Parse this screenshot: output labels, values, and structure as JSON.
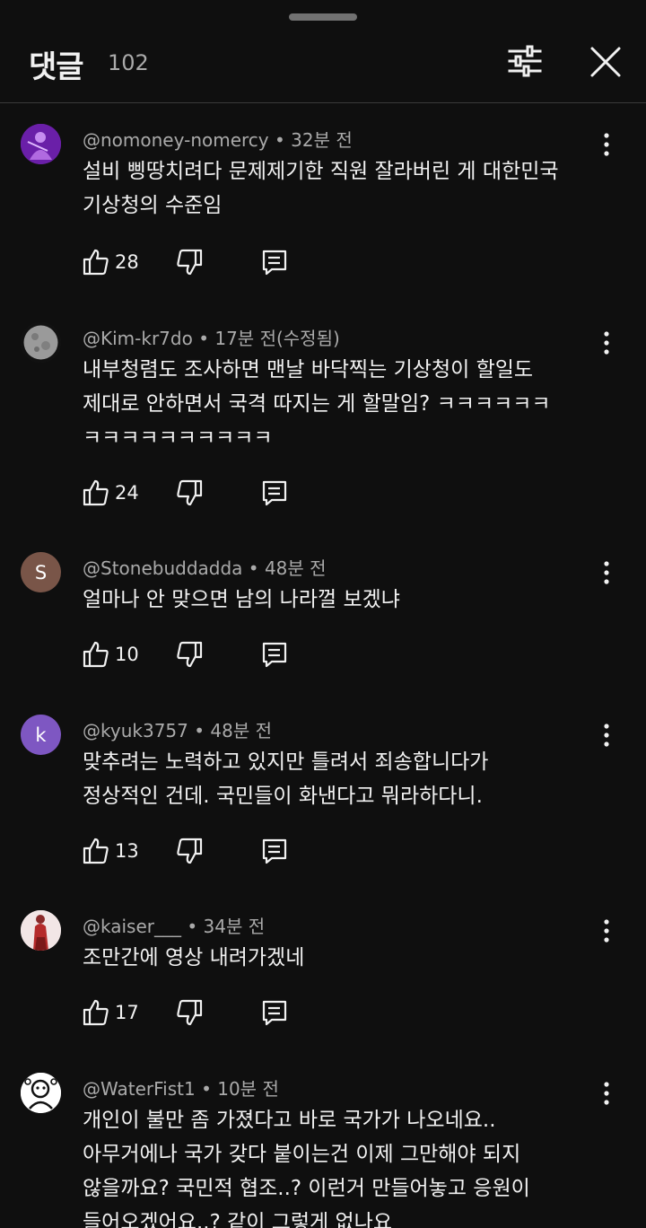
{
  "header": {
    "title": "댓글",
    "count": "102"
  },
  "colors": {
    "background": "#0f0f0f",
    "text_primary": "#f1f1f1",
    "text_secondary": "#aaaaaa",
    "divider": "#3a3a3a"
  },
  "comments": [
    {
      "handle": "@nomoney-nomercy",
      "time": "32분 전",
      "avatar_letter": "",
      "avatar_color": "#7a2fb0",
      "lines": [
        "설비 삥땅치려다 문제제기한 직원 잘라버린 게 대한민국",
        "기상청의 수준임"
      ],
      "likes": "28"
    },
    {
      "handle": "@Kim-kr7do",
      "time": "17분 전(수정됨)",
      "avatar_letter": "",
      "avatar_color": "#555555",
      "lines": [
        "내부청렴도 조사하면 맨날 바닥찍는 기상청이 할일도",
        "제대로 안하면서 국격 따지는 게 할말임? ㅋㅋㅋㅋㅋㅋ",
        "ㅋㅋㅋㅋㅋㅋㅋㅋㅋㅋ"
      ],
      "likes": "24"
    },
    {
      "handle": "@Stonebuddadda",
      "time": "48분 전",
      "avatar_letter": "S",
      "avatar_color": "#795548",
      "lines": [
        "얼마나 안 맞으면 남의 나라껄 보겠냐"
      ],
      "likes": "10"
    },
    {
      "handle": "@kyuk3757",
      "time": "48분 전",
      "avatar_letter": "k",
      "avatar_color": "#7e57c2",
      "lines": [
        "맞추려는 노력하고 있지만 틀려서 죄송합니다가",
        "정상적인 건데. 국민들이 화낸다고 뭐라하다니."
      ],
      "likes": "13"
    },
    {
      "handle": "@kaiser___",
      "time": "34분 전",
      "avatar_letter": "",
      "avatar_color": "#f2e6e6",
      "lines": [
        "조만간에 영상 내려가겠네"
      ],
      "likes": "17"
    },
    {
      "handle": "@WaterFist1",
      "time": "10분 전",
      "avatar_letter": "",
      "avatar_color": "#ffffff",
      "lines": [
        "개인이 불만 좀 가졌다고 바로 국가가 나오네요..",
        "아무거에나 국가 갖다 붙이는건 이제 그만해야 되지",
        "않을까요? 국민적 협조..? 이런거 만들어놓고 응원이",
        "들어오겠어요..? 같이 그렇게 없나요"
      ],
      "likes": ""
    }
  ]
}
